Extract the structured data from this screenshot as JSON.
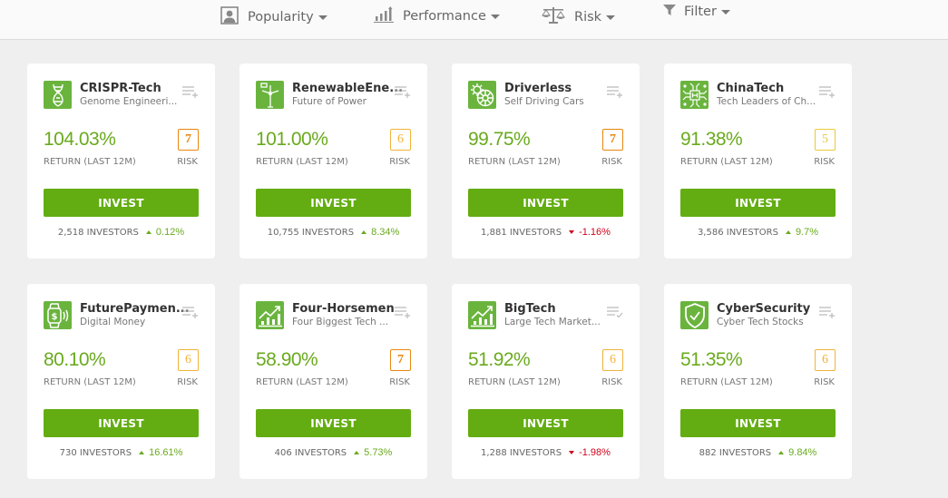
{
  "toolbar": {
    "sorts": [
      {
        "label": "Popularity",
        "icon": "person-icon"
      },
      {
        "label": "Performance",
        "icon": "bar-chart-icon"
      },
      {
        "label": "Risk",
        "icon": "scales-icon"
      },
      {
        "label": "Filter",
        "icon": "funnel-icon"
      }
    ]
  },
  "colors": {
    "accent_green": "#63ad12",
    "return_green": "#6aaa1e",
    "negative_red": "#d0021b",
    "risk_7": "#e8870e",
    "risk_6": "#f0b33a",
    "risk_5": "#e8c93a"
  },
  "common": {
    "return_label": "RETURN (LAST 12M)",
    "risk_label": "RISK",
    "invest_label": "INVEST"
  },
  "cards": [
    {
      "name": "CRISPR-Tech",
      "subtitle": "Genome Engineeri...",
      "icon": "dna-icon",
      "return": "104.03%",
      "risk": "7",
      "investors": "2,518 INVESTORS",
      "change": "0.12%",
      "direction": "up",
      "watchlist": "add"
    },
    {
      "name": "RenewableEne...",
      "subtitle": "Future of Power",
      "icon": "wind-turbine-icon",
      "return": "101.00%",
      "risk": "6",
      "investors": "10,755 INVESTORS",
      "change": "8.34%",
      "direction": "up",
      "watchlist": "add"
    },
    {
      "name": "Driverless",
      "subtitle": "Self Driving Cars",
      "icon": "gear-wheel-icon",
      "return": "99.75%",
      "risk": "7",
      "investors": "1,881 INVESTORS",
      "change": "-1.16%",
      "direction": "down",
      "watchlist": "add"
    },
    {
      "name": "ChinaTech",
      "subtitle": "Tech Leaders of Ch...",
      "icon": "chip-icon",
      "return": "91.38%",
      "risk": "5",
      "investors": "3,586 INVESTORS",
      "change": "9.7%",
      "direction": "up",
      "watchlist": "add"
    },
    {
      "name": "FuturePaymen...",
      "subtitle": "Digital Money",
      "icon": "smartwatch-pay-icon",
      "return": "80.10%",
      "risk": "6",
      "investors": "730 INVESTORS",
      "change": "16.61%",
      "direction": "up",
      "watchlist": "add"
    },
    {
      "name": "Four-Horsemen",
      "subtitle": "Four Biggest Tech ...",
      "icon": "growth-chart-icon",
      "return": "58.90%",
      "risk": "7",
      "investors": "406 INVESTORS",
      "change": "5.73%",
      "direction": "up",
      "watchlist": "add"
    },
    {
      "name": "BigTech",
      "subtitle": "Large Tech Market...",
      "icon": "growth-chart-icon",
      "return": "51.92%",
      "risk": "6",
      "investors": "1,288 INVESTORS",
      "change": "-1.98%",
      "direction": "down",
      "watchlist": "added"
    },
    {
      "name": "CyberSecurity",
      "subtitle": "Cyber Tech Stocks",
      "icon": "shield-check-icon",
      "return": "51.35%",
      "risk": "6",
      "investors": "882 INVESTORS",
      "change": "9.84%",
      "direction": "up",
      "watchlist": "add"
    }
  ]
}
